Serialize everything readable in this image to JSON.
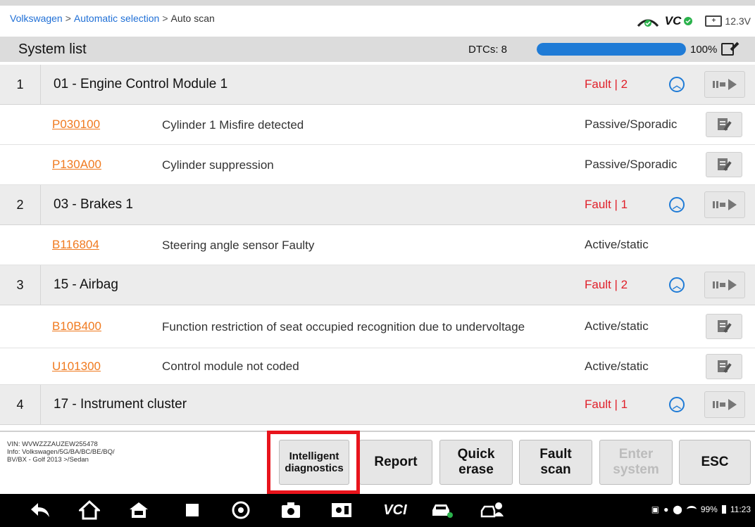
{
  "breadcrumb": {
    "items": [
      "Volkswagen",
      "Automatic selection",
      "Auto scan"
    ],
    "separator": ">"
  },
  "status": {
    "vci_label": "VC",
    "voltage": "12.3V"
  },
  "header": {
    "title": "System list",
    "dtcs": "DTCs: 8",
    "progress_percent": 100,
    "progress_label": "100%"
  },
  "systems": [
    {
      "num": "1",
      "name": "01 - Engine Control Module 1",
      "fault": "Fault | 2",
      "dtcs": [
        {
          "code": "P030100",
          "desc": "Cylinder 1  Misfire detected",
          "state": "Passive/Sporadic",
          "has_note": true
        },
        {
          "code": "P130A00",
          "desc": "Cylinder suppression",
          "state": "Passive/Sporadic",
          "has_note": true
        }
      ]
    },
    {
      "num": "2",
      "name": "03 - Brakes 1",
      "fault": "Fault | 1",
      "dtcs": [
        {
          "code": "B116804",
          "desc": "Steering angle sensor  Faulty",
          "state": "Active/static",
          "has_note": false
        }
      ]
    },
    {
      "num": "3",
      "name": "15 - Airbag",
      "fault": "Fault | 2",
      "dtcs": [
        {
          "code": "B10B400",
          "desc": "Function restriction of seat occupied recognition  due to undervoltage",
          "state": "Active/static",
          "has_note": true
        },
        {
          "code": "U101300",
          "desc": "Control module not coded",
          "state": "Active/static",
          "has_note": true
        }
      ]
    },
    {
      "num": "4",
      "name": "17 - Instrument cluster",
      "fault": "Fault | 1",
      "dtcs": []
    }
  ],
  "footer": {
    "vin": "VIN: WVWZZZAUZEW255478",
    "info_line1": "Info: Volkswagen/5G/BA/BC/BE/BQ/",
    "info_line2": "BV/BX - Golf 2013 >/Sedan",
    "buttons": {
      "intelligent_line1": "Intelligent",
      "intelligent_line2": "diagnostics",
      "report": "Report",
      "quick_line1": "Quick",
      "quick_line2": "erase",
      "fault_line1": "Fault",
      "fault_line2": "scan",
      "enter_line1": "Enter",
      "enter_line2": "system",
      "esc": "ESC"
    }
  },
  "navbar": {
    "vci_label": "VCI",
    "battery": "99%",
    "time": "11:23"
  },
  "colors": {
    "accent_blue": "#1f7bd6",
    "fault_red": "#e0202a",
    "code_orange": "#f07a1f",
    "highlight_red": "#e8141c"
  }
}
